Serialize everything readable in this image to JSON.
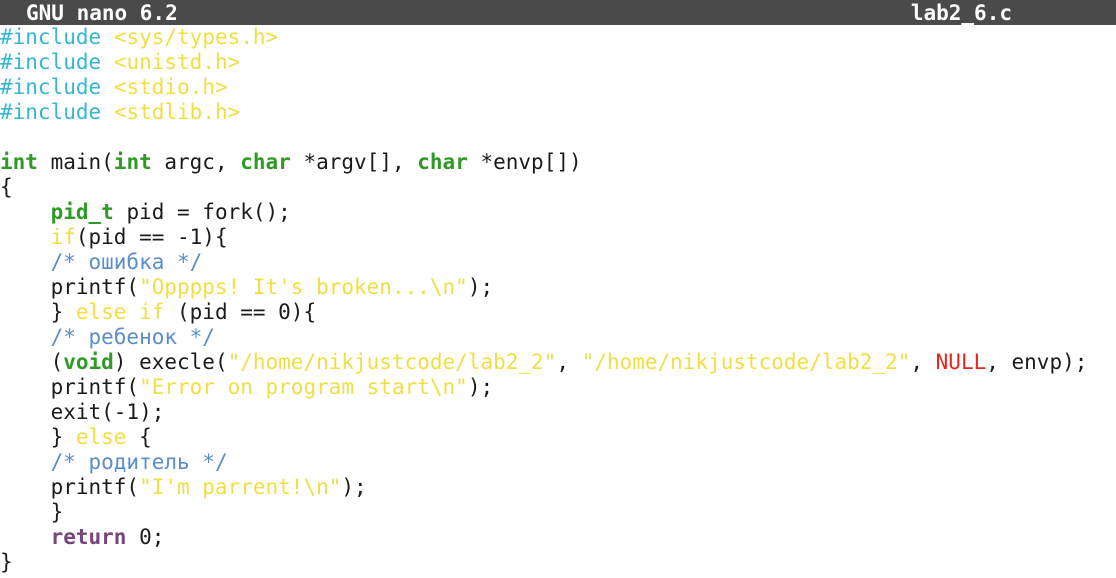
{
  "titlebar": {
    "app": "GNU nano 6.2",
    "file": "lab2_6.c"
  },
  "colors": {
    "titlebar_bg": "#4a4a4a",
    "preprocessor": "#35b7d3",
    "include_path": "#f0df44",
    "type": "#2f9b26",
    "keyword": "#f0df44",
    "comment": "#5b8ec9",
    "string": "#f0df44",
    "null_constant": "#e5261f",
    "return_keyword": "#77457a"
  },
  "code": [
    [
      {
        "c": "pre",
        "t": "#include"
      },
      {
        "c": "plain",
        "t": " "
      },
      {
        "c": "inc",
        "t": "<sys/types.h>"
      }
    ],
    [
      {
        "c": "pre",
        "t": "#include"
      },
      {
        "c": "plain",
        "t": " "
      },
      {
        "c": "inc",
        "t": "<unistd.h>"
      }
    ],
    [
      {
        "c": "pre",
        "t": "#include"
      },
      {
        "c": "plain",
        "t": " "
      },
      {
        "c": "inc",
        "t": "<stdio.h>"
      }
    ],
    [
      {
        "c": "pre",
        "t": "#include"
      },
      {
        "c": "plain",
        "t": " "
      },
      {
        "c": "inc",
        "t": "<stdlib.h>"
      }
    ],
    [],
    [
      {
        "c": "typ",
        "t": "int"
      },
      {
        "c": "plain",
        "t": " main("
      },
      {
        "c": "typ",
        "t": "int"
      },
      {
        "c": "plain",
        "t": " argc, "
      },
      {
        "c": "typ",
        "t": "char"
      },
      {
        "c": "plain",
        "t": " *argv[], "
      },
      {
        "c": "typ",
        "t": "char"
      },
      {
        "c": "plain",
        "t": " *envp[])"
      }
    ],
    [
      {
        "c": "plain",
        "t": "{"
      }
    ],
    [
      {
        "c": "plain",
        "t": "    "
      },
      {
        "c": "typ",
        "t": "pid_t"
      },
      {
        "c": "plain",
        "t": " pid = fork();"
      }
    ],
    [
      {
        "c": "plain",
        "t": "    "
      },
      {
        "c": "kw",
        "t": "if"
      },
      {
        "c": "plain",
        "t": "(pid == -1){"
      }
    ],
    [
      {
        "c": "plain",
        "t": "    "
      },
      {
        "c": "cmt",
        "t": "/* ошибка */"
      }
    ],
    [
      {
        "c": "plain",
        "t": "    printf("
      },
      {
        "c": "str",
        "t": "\"Opppps! It's broken...\\n\""
      },
      {
        "c": "plain",
        "t": ");"
      }
    ],
    [
      {
        "c": "plain",
        "t": "    } "
      },
      {
        "c": "kw",
        "t": "else if"
      },
      {
        "c": "plain",
        "t": " (pid == 0){"
      }
    ],
    [
      {
        "c": "plain",
        "t": "    "
      },
      {
        "c": "cmt",
        "t": "/* ребенок */"
      }
    ],
    [
      {
        "c": "plain",
        "t": "    ("
      },
      {
        "c": "typ",
        "t": "void"
      },
      {
        "c": "plain",
        "t": ") execle("
      },
      {
        "c": "str",
        "t": "\"/home/nikjustcode/lab2_2\""
      },
      {
        "c": "plain",
        "t": ", "
      },
      {
        "c": "str",
        "t": "\"/home/nikjustcode/lab2_2\""
      },
      {
        "c": "plain",
        "t": ", "
      },
      {
        "c": "nul",
        "t": "NULL"
      },
      {
        "c": "plain",
        "t": ", envp);"
      }
    ],
    [
      {
        "c": "plain",
        "t": "    printf("
      },
      {
        "c": "str",
        "t": "\"Error on program start\\n\""
      },
      {
        "c": "plain",
        "t": ");"
      }
    ],
    [
      {
        "c": "plain",
        "t": "    exit(-1);"
      }
    ],
    [
      {
        "c": "plain",
        "t": "    } "
      },
      {
        "c": "kw",
        "t": "else"
      },
      {
        "c": "plain",
        "t": " {"
      }
    ],
    [
      {
        "c": "plain",
        "t": "    "
      },
      {
        "c": "cmt",
        "t": "/* родитель */"
      }
    ],
    [
      {
        "c": "plain",
        "t": "    printf("
      },
      {
        "c": "str",
        "t": "\"I'm parrent!\\n\""
      },
      {
        "c": "plain",
        "t": ");"
      }
    ],
    [
      {
        "c": "plain",
        "t": "    }"
      }
    ],
    [
      {
        "c": "plain",
        "t": "    "
      },
      {
        "c": "ret",
        "t": "return"
      },
      {
        "c": "plain",
        "t": " 0;"
      }
    ],
    [
      {
        "c": "plain",
        "t": "}"
      }
    ]
  ]
}
